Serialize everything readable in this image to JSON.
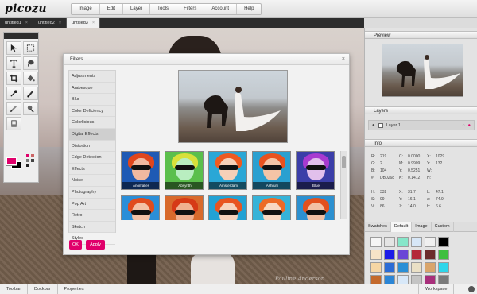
{
  "app": {
    "logo": "picozu"
  },
  "menu": [
    "Image",
    "Edit",
    "Layer",
    "Tools",
    "Filters",
    "Account",
    "Help"
  ],
  "tabs": [
    {
      "label": "untitled1",
      "close": "×",
      "active": false
    },
    {
      "label": "untitled2",
      "close": "×",
      "active": false
    },
    {
      "label": "untitled3",
      "close": "×",
      "active": true
    }
  ],
  "canvas": {
    "watermark": "Pauline Anderson"
  },
  "tools": [
    "select-arrow-icon",
    "rect-select-icon",
    "text-icon",
    "lasso-icon",
    "crop-icon",
    "bucket-icon",
    "eyedropper-icon",
    "brush-icon",
    "pencil-icon",
    "clone-icon",
    "eraser-icon"
  ],
  "colors": {
    "accent": "#e0006b",
    "foreground": "#e0006b",
    "background": "#000000"
  },
  "filters": {
    "title": "Filters",
    "close": "×",
    "categories": [
      "Adjustments",
      "Arabesque",
      "Blur",
      "Color Deficiency",
      "Colorlicious",
      "Digital Effects",
      "Distortion",
      "Edge Detection",
      "Effects",
      "Noise",
      "Photography",
      "Pop Art",
      "Retro",
      "Sketch",
      "Styles"
    ],
    "selected": "Digital Effects",
    "thumbs_row1": [
      "Anomalies",
      "Absynth",
      "Amsterdam",
      "Ashrum",
      "Blue"
    ],
    "thumbs_row2": [
      "",
      "",
      "",
      "",
      ""
    ],
    "ok_label": "OK",
    "apply_label": "Apply"
  },
  "panels": {
    "preview_title": "Preview",
    "layers_title": "Layers",
    "layer_name": "Layer 1",
    "info_title": "Info",
    "info_rows": [
      [
        "R:",
        "219",
        "C:",
        "0.0000",
        "X:",
        "1029"
      ],
      [
        "G:",
        "2",
        "M:",
        "0.9909",
        "Y:",
        "132"
      ],
      [
        "B:",
        "104",
        "Y:",
        "0.5251",
        "W:",
        ""
      ],
      [
        "#:",
        "DB0268",
        "K:",
        "0.1412",
        "H:",
        ""
      ],
      [
        "",
        "",
        "",
        "",
        "",
        ""
      ],
      [
        "H:",
        "332",
        "X:",
        "31.7",
        "L:",
        "47.1"
      ],
      [
        "S:",
        "99",
        "Y:",
        "16.1",
        "a:",
        "74.9"
      ],
      [
        "V:",
        "86",
        "Z:",
        "14.0",
        "b:",
        "6.6"
      ]
    ],
    "swatches_label": "Swatches",
    "swatch_tabs": [
      "Default",
      "Image",
      "Custom"
    ],
    "swatch_colors": [
      "#f5f5f5",
      "#e4e4e4",
      "#86e6c9",
      "#d7e7f7",
      "#f0f0f0",
      "#000000",
      "#f7e3c7",
      "#1c1ce8",
      "#6a46d6",
      "#b42839",
      "#6c2c2c",
      "#3fbf3f",
      "#f6d6a4",
      "#2b6cd6",
      "#2a8fd6",
      "#eae0c6",
      "#d9a56b",
      "#2fd6ea",
      "#c46a2c",
      "#2c86d6",
      "#d8e8f8",
      "#c4c4c4",
      "#a82f7b",
      "#7a7a7a",
      "#c45a1a",
      "#1a9ad6",
      "#2ac42a",
      "#7ad62a",
      "#1a1a9a",
      "#5a2a1a"
    ]
  },
  "bottombar": [
    "Toolbar",
    "Dockbar",
    "Properties"
  ],
  "workspace_label": "Workspace"
}
